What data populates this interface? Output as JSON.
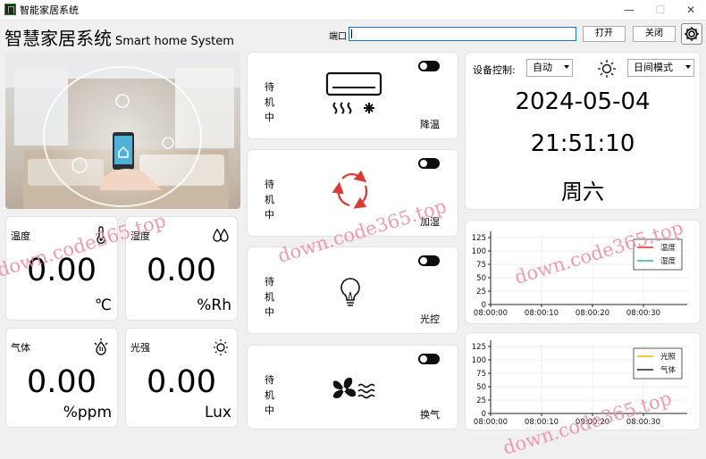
{
  "window": {
    "title": "智能家居系统",
    "minimize": "—",
    "maximize": "☐",
    "close": "✕"
  },
  "header": {
    "title": "智慧家居系统",
    "subtitle": "Smart home System",
    "port_label": "端口",
    "port_value": "",
    "open_button": "打开",
    "close_button": "关闭"
  },
  "sensors": [
    {
      "label": "温度",
      "value": "0.00",
      "unit": "℃",
      "icon": "thermometer-icon"
    },
    {
      "label": "湿度",
      "value": "0.00",
      "unit": "%Rh",
      "icon": "humidity-drops-icon"
    },
    {
      "label": "气体",
      "value": "0.00",
      "unit": "%ppm",
      "icon": "gas-icon"
    },
    {
      "label": "光强",
      "value": "0.00",
      "unit": "Lux",
      "icon": "sun-icon"
    }
  ],
  "devices": [
    {
      "status": "待机中",
      "label": "降温",
      "icon": "air-conditioner-icon",
      "on": false
    },
    {
      "status": "待机中",
      "label": "加湿",
      "icon": "humidifier-cycle-icon",
      "on": false
    },
    {
      "status": "待机中",
      "label": "光控",
      "icon": "light-bulb-icon",
      "on": false
    },
    {
      "status": "待机中",
      "label": "换气",
      "icon": "ventilation-fan-icon",
      "on": false
    }
  ],
  "control": {
    "label": "设备控制:",
    "mode": "自动",
    "day_mode": "日间模式",
    "date": "2024-05-04",
    "time": "21:51:10",
    "weekday": "周六"
  },
  "watermark": "down.code365.top",
  "chart_data": [
    {
      "type": "line",
      "x_ticks": [
        "08:00:00",
        "08:00:10",
        "08:00:20",
        "08:00:30"
      ],
      "y_ticks": [
        0,
        25,
        50,
        75,
        100,
        125
      ],
      "ylim": [
        0,
        130
      ],
      "grid": true,
      "legend_position": "top-right",
      "series": [
        {
          "name": "温度",
          "color": "#e03030",
          "values": []
        },
        {
          "name": "湿度",
          "color": "#3fa6b8",
          "values": []
        }
      ]
    },
    {
      "type": "line",
      "x_ticks": [
        "08:00:00",
        "08:00:10",
        "08:00:20",
        "08:00:30"
      ],
      "y_ticks": [
        0,
        25,
        50,
        75,
        100,
        125
      ],
      "ylim": [
        0,
        130
      ],
      "grid": true,
      "legend_position": "top-right",
      "series": [
        {
          "name": "光照",
          "color": "#f0b400",
          "values": []
        },
        {
          "name": "气体",
          "color": "#222222",
          "values": []
        }
      ]
    }
  ]
}
